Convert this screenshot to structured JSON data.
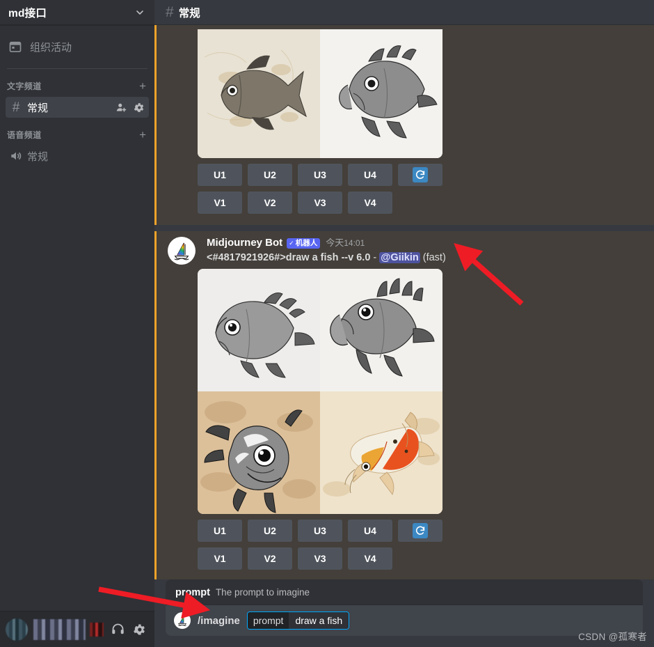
{
  "sidebar": {
    "server_name": "md接口",
    "events": {
      "label": "组织活动",
      "icon": "calendar-icon"
    },
    "text_category": {
      "label": "文字频道",
      "add_label": "+"
    },
    "voice_category": {
      "label": "语音频道",
      "add_label": "+"
    },
    "text_channels": [
      {
        "name": "常规",
        "active": true,
        "icons": [
          "add-member-icon",
          "gear-icon"
        ]
      }
    ],
    "voice_channels": [
      {
        "name": "常规",
        "icon": "speaker-icon"
      }
    ],
    "user_panel": {
      "avatar": "user-avatar-blurred",
      "username": "username-blurred",
      "icons": [
        "mic-muted-icon",
        "headphones-icon",
        "user-settings-gear-icon"
      ]
    }
  },
  "header": {
    "hash": "#",
    "channel_title": "常规"
  },
  "messages": [
    {
      "id": "msg-top-partial",
      "partial": true,
      "images": [
        {
          "alt": "pencil sketch of fish on tan paper"
        },
        {
          "alt": "detailed pencil sketch of bass fish on white paper"
        }
      ],
      "buttons_row1": [
        "U1",
        "U2",
        "U3",
        "U4"
      ],
      "refresh_button": "refresh-icon",
      "buttons_row2": [
        "V1",
        "V2",
        "V3",
        "V4"
      ]
    },
    {
      "id": "msg-midjourney",
      "partial": false,
      "author": "Midjourney Bot",
      "bot_badge": "机器人",
      "bot_badge_tick": "✓",
      "timestamp_day": "今天",
      "timestamp_time": "14:01",
      "prompt_text": "<#4817921926#>draw a fish --v 6.0",
      "separator": "-",
      "mention": "@Giikin",
      "speed": "(fast)",
      "images": [
        {
          "alt": "grey pencil sketch fish head left"
        },
        {
          "alt": "pencil sketch bass fish open mouth"
        },
        {
          "alt": "charcoal sketch fish frontal on tan paper"
        },
        {
          "alt": "watercolor koi fish orange and white"
        }
      ],
      "buttons_row1": [
        "U1",
        "U2",
        "U3",
        "U4"
      ],
      "refresh_button": "refresh-icon",
      "buttons_row2": [
        "V1",
        "V2",
        "V3",
        "V4"
      ]
    }
  ],
  "composer": {
    "popout": {
      "param_name": "prompt",
      "param_desc": "The prompt to imagine"
    },
    "command_name": "/imagine",
    "chip_key": "prompt",
    "chip_value": "draw a fish",
    "avatar": "midjourney-avatar"
  },
  "watermark": "CSDN @孤寒者",
  "colors": {
    "accent_highlight": "#f0a32a",
    "message_highlight_bg": "#443f3a",
    "sidebar_bg": "#2f3136",
    "main_bg": "#36393f",
    "blurple": "#5865f2",
    "chip_border": "#00a8fc",
    "refresh_blue": "#3b88c3",
    "arrow_red": "#ee1c25"
  }
}
